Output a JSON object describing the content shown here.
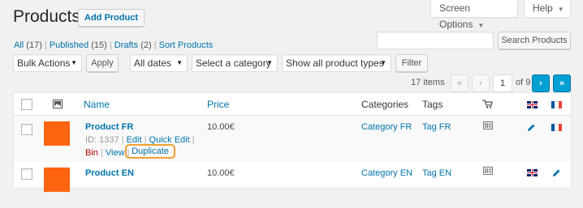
{
  "header": {
    "title": "Products",
    "add_button": "Add Product",
    "screen_options": "Screen Options",
    "help": "Help"
  },
  "filters": {
    "all": "All",
    "all_count": "(17)",
    "published": "Published",
    "published_count": "(15)",
    "drafts": "Drafts",
    "drafts_count": "(2)",
    "sort": "Sort Products"
  },
  "search": {
    "value": "",
    "placeholder": "",
    "button": "Search Products"
  },
  "tablenav": {
    "bulk_actions": "Bulk Actions",
    "apply": "Apply",
    "dates": "All dates",
    "category": "Select a category",
    "product_types": "Show all product types",
    "filter": "Filter",
    "items": "17 items",
    "first": "«",
    "prev": "‹",
    "page": "1",
    "of_pages": "of 9",
    "next": "›",
    "last": "»"
  },
  "columns": {
    "name": "Name",
    "price": "Price",
    "categories": "Categories",
    "tags": "Tags"
  },
  "rows": [
    {
      "name": "Product FR",
      "id_text": "ID: 1337",
      "edit": "Edit",
      "quick_edit": "Quick Edit",
      "bin": "Bin",
      "view": "View",
      "duplicate": "Duplicate",
      "price": "10.00€",
      "category": "Category FR",
      "tag": "Tag FR"
    },
    {
      "name": "Product EN",
      "price": "10.00€",
      "category": "Category EN",
      "tag": "Tag EN"
    }
  ],
  "colors": {
    "link": "#0073aa",
    "thumbnail": "#ff6411",
    "bin": "#a00",
    "highlight": "#f0a030"
  },
  "icons": [
    "image-icon",
    "cart-icon",
    "barcode-icon",
    "pencil-icon",
    "flag-gb-icon",
    "flag-fr-icon",
    "caret-down-icon"
  ]
}
